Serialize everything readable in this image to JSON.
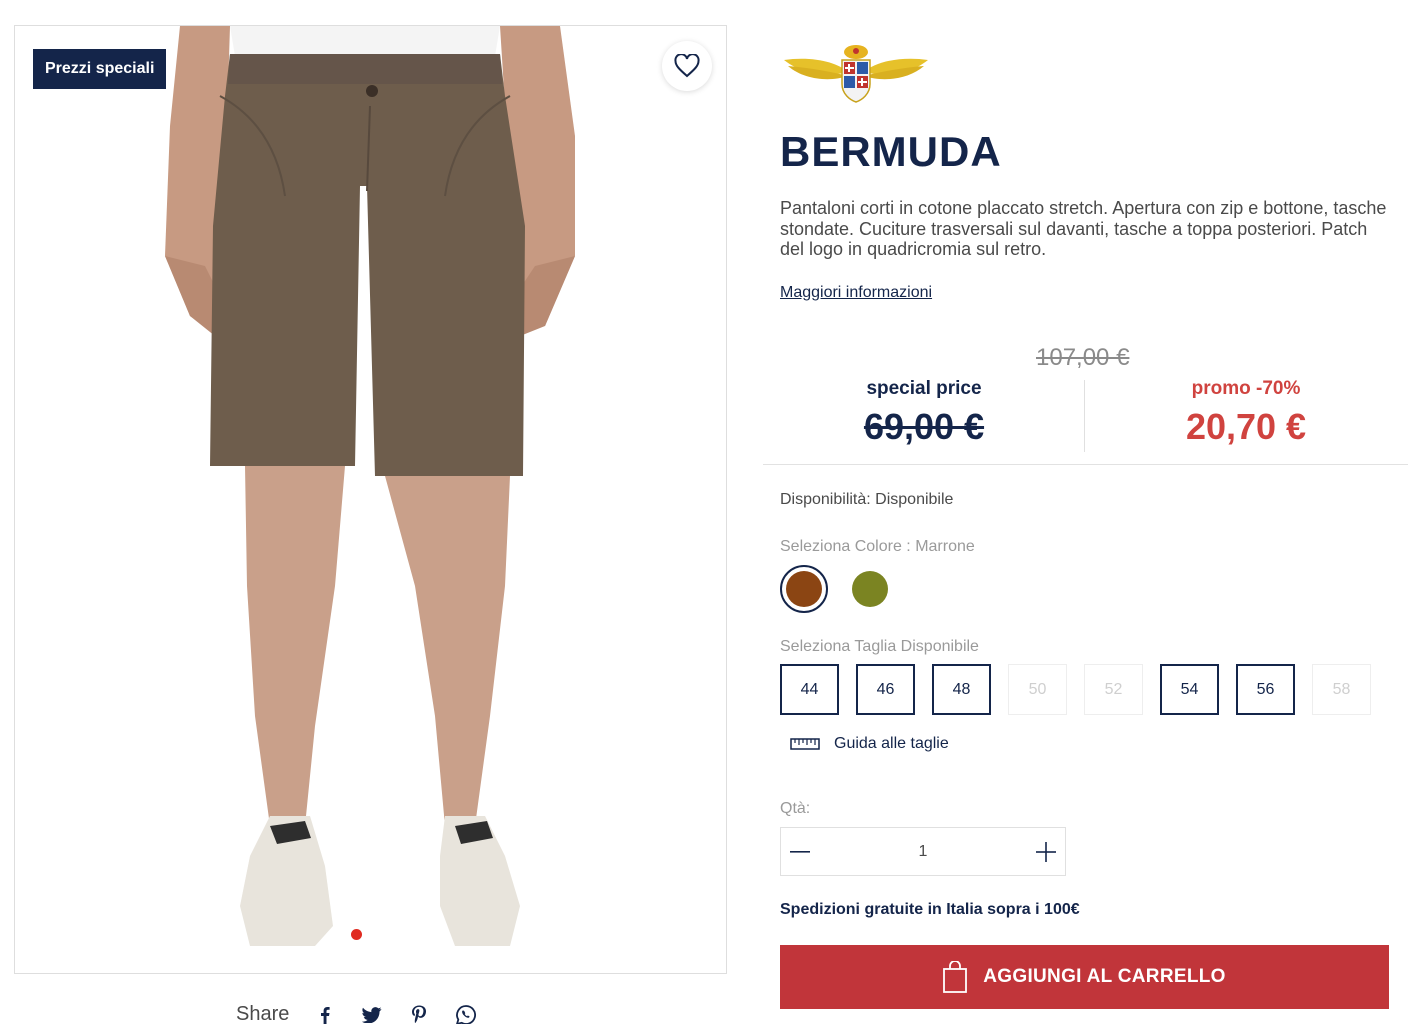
{
  "gallery": {
    "badge": "Prezzi speciali",
    "share_label": "Share",
    "share_icons": [
      "facebook-icon",
      "twitter-icon",
      "pinterest-icon",
      "whatsapp-icon"
    ]
  },
  "product": {
    "title": "BERMUDA",
    "description": "Pantaloni corti in cotone placcato stretch. Apertura con zip e bottone, tasche stondate. Cuciture trasversali sul davanti, tasche a toppa posteriori. Patch del logo in quadricromia sul retro.",
    "more_info": "Maggiori informazioni"
  },
  "pricing": {
    "original": "107,00 €",
    "special_label": "special price",
    "special_value": "69,00 €",
    "promo_label": "promo -70%",
    "promo_value": "20,70 €"
  },
  "availability": "Disponibilità: Disponibile",
  "colors": {
    "label": "Seleziona Colore : Marrone",
    "options": [
      {
        "name": "Marrone",
        "hex": "#8b4513",
        "selected": true
      },
      {
        "name": "Verde",
        "hex": "#7b8422",
        "selected": false
      }
    ]
  },
  "sizes": {
    "label": "Seleziona Taglia Disponibile",
    "options": [
      {
        "label": "44",
        "available": true
      },
      {
        "label": "46",
        "available": true
      },
      {
        "label": "48",
        "available": true
      },
      {
        "label": "50",
        "available": false
      },
      {
        "label": "52",
        "available": false
      },
      {
        "label": "54",
        "available": true
      },
      {
        "label": "56",
        "available": true
      },
      {
        "label": "58",
        "available": false
      }
    ]
  },
  "size_guide": "Guida alle taglie",
  "quantity": {
    "label": "Qtà:",
    "value": "1"
  },
  "shipping": "Spedizioni gratuite in Italia sopra i 100€",
  "cart_button": "AGGIUNGI AL CARRELLO",
  "colors_theme": {
    "navy": "#14254a",
    "promo_red": "#d0433f",
    "cart_red": "#c1353a"
  }
}
